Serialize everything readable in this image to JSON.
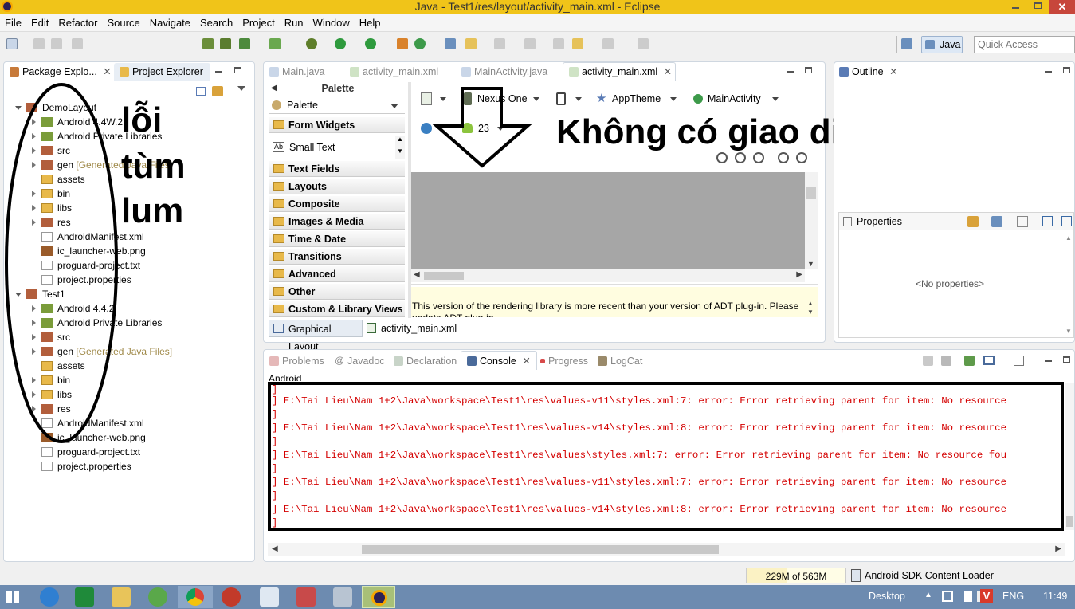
{
  "window": {
    "title": "Java - Test1/res/layout/activity_main.xml - Eclipse"
  },
  "menu": [
    "File",
    "Edit",
    "Refactor",
    "Source",
    "Navigate",
    "Search",
    "Project",
    "Run",
    "Window",
    "Help"
  ],
  "perspective": {
    "label": "Java",
    "quick_access_placeholder": "Quick Access"
  },
  "left_tabs": {
    "package_explorer": "Package Explo...",
    "project_explorer": "Project Explorer"
  },
  "tree": {
    "p1": {
      "name": "DemoLayout",
      "items": [
        "Android 4.4W.2",
        "Android Private Libraries",
        "src",
        "gen",
        "[Generated Java Files]",
        "assets",
        "bin",
        "libs",
        "res",
        "AndroidManifest.xml",
        "ic_launcher-web.png",
        "proguard-project.txt",
        "project.properties"
      ]
    },
    "p2": {
      "name": "Test1",
      "items": [
        "Android 4.4.2",
        "Android Private Libraries",
        "src",
        "gen",
        "[Generated Java Files]",
        "assets",
        "bin",
        "libs",
        "res",
        "AndroidManifest.xml",
        "ic_launcher-web.png",
        "proguard-project.txt",
        "project.properties"
      ]
    }
  },
  "editor_tabs": [
    "Main.java",
    "activity_main.xml",
    "MainActivity.java",
    "activity_main.xml"
  ],
  "palette": {
    "header": "Palette",
    "dropdown": "Palette",
    "groups": [
      "Form Widgets",
      "Small Text",
      "Text Fields",
      "Layouts",
      "Composite",
      "Images & Media",
      "Time & Date",
      "Transitions",
      "Advanced",
      "Other",
      "Custom & Library Views"
    ]
  },
  "layout_toolbar": {
    "device": "Nexus One",
    "theme": "AppTheme",
    "activity": "MainActivity",
    "api": "23"
  },
  "warning_text": "This version of the rendering library is more recent than your version of ADT plug-in. Please",
  "warning_text_2": "update ADT plug-in",
  "bottom_tabs": {
    "graphical": "Graphical Layout",
    "xml": "activity_main.xml"
  },
  "outline": {
    "title": "Outline"
  },
  "properties": {
    "title": "Properties",
    "empty": "<No properties>"
  },
  "console_tabs": [
    "Problems",
    "Javadoc",
    "Declaration",
    "Console",
    "Progress",
    "LogCat"
  ],
  "console": {
    "header": "Android",
    "lines": [
      "] E:\\Tai Lieu\\Nam 1+2\\Java\\workspace\\Test1\\res\\values-v11\\styles.xml:7: error: Error retrieving parent for item: No resource",
      "] E:\\Tai Lieu\\Nam 1+2\\Java\\workspace\\Test1\\res\\values-v14\\styles.xml:8: error: Error retrieving parent for item: No resource",
      "] E:\\Tai Lieu\\Nam 1+2\\Java\\workspace\\Test1\\res\\values\\styles.xml:7: error: Error retrieving parent for item: No resource fou",
      "] E:\\Tai Lieu\\Nam 1+2\\Java\\workspace\\Test1\\res\\values-v11\\styles.xml:7: error: Error retrieving parent for item: No resource",
      "] E:\\Tai Lieu\\Nam 1+2\\Java\\workspace\\Test1\\res\\values-v14\\styles.xml:8: error: Error retrieving parent for item: No resource"
    ]
  },
  "status": {
    "memory": "229M of 563M",
    "loader": "Android SDK Content Loader"
  },
  "annotations": {
    "loi1": "lỗi",
    "loi2": "tùm",
    "loi3": "lum",
    "no_ui": "Không có giao diện"
  },
  "taskbar": {
    "desktop": "Desktop",
    "lang": "ENG",
    "time": "11:49"
  }
}
